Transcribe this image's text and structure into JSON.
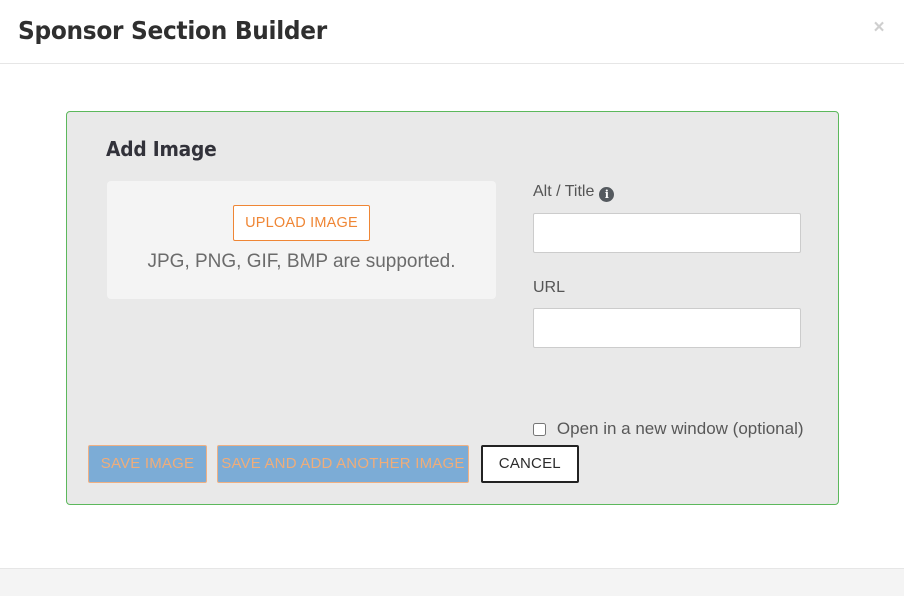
{
  "header": {
    "title": "Sponsor Section Builder",
    "close_label": "×"
  },
  "panel": {
    "heading": "Add Image",
    "border_color": "#5cb85c",
    "background_color": "#e9e9e9"
  },
  "upload": {
    "button_label": "UPLOAD IMAGE",
    "hint": "JPG, PNG, GIF, BMP are supported.",
    "accent_color": "#ef8635"
  },
  "form": {
    "alt_title": {
      "label": "Alt / Title",
      "info_icon": "info-icon",
      "info_glyph": "i",
      "value": "",
      "placeholder": ""
    },
    "url": {
      "label": "URL",
      "value": "",
      "placeholder": ""
    },
    "new_window": {
      "label": "Open in a new window (optional)",
      "checked": false
    }
  },
  "actions": {
    "save_image": "SAVE IMAGE",
    "save_and_add_another": "SAVE AND ADD ANOTHER IMAGE",
    "cancel": "CANCEL",
    "disabled_bg": "#7cacd6",
    "disabled_text": "#f0ad79"
  }
}
